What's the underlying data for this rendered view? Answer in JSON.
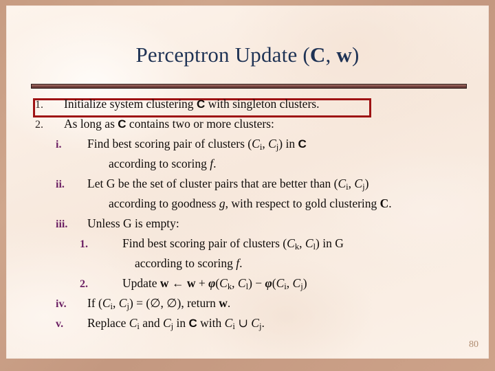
{
  "slide": {
    "title_plain": "Perceptron Update (C, w)",
    "title_pre": "Perceptron Update (",
    "title_c": "C",
    "title_comma": ", ",
    "title_w": "w",
    "title_post": ")",
    "page_number": "80",
    "accent_colors": {
      "title": "#1f3355",
      "highlight_box": "#9e1213",
      "roman_marker": "#6b1f63",
      "divider": "#7d4a45",
      "page_number": "#b08d72",
      "background_frame": "#c79c82",
      "paper": "#faeee4"
    }
  },
  "items": [
    {
      "marker": "1.",
      "level": 1,
      "highlighted": true,
      "text": "Initialize system clustering C with singleton clusters.",
      "parts": {
        "a": "Initialize system clustering ",
        "b": "C",
        "c": " with singleton clusters."
      }
    },
    {
      "marker": "2.",
      "level": 1,
      "highlighted": false,
      "text": "As long as C contains two or more clusters:",
      "parts": {
        "a": "As long as ",
        "b": "C",
        "c": " contains two or more clusters:"
      }
    },
    {
      "marker": "i.",
      "level": 2,
      "highlighted": false,
      "text": "Find best scoring pair of clusters (Ci, Cj) in C",
      "parts": {
        "a": "Find best scoring pair of clusters (",
        "b": "C",
        "sub1": "i",
        "c": ", ",
        "d": "C",
        "sub2": "j",
        "e": ") in ",
        "f": "C"
      },
      "continuation": {
        "a": "according to scoring ",
        "b": "f",
        "c": "."
      }
    },
    {
      "marker": "ii.",
      "level": 2,
      "highlighted": false,
      "text": "Let G be the set of cluster pairs that are better than (Ci, Cj)",
      "parts": {
        "a": "Let G be the set of cluster pairs that are better than (",
        "b": "C",
        "sub1": "i",
        "c": ", ",
        "d": "C",
        "sub2": "j",
        "e": ")"
      },
      "continuation": {
        "a": "according to goodness ",
        "b": "g",
        "c": ", with respect to gold clustering ",
        "d": "C",
        "e": "."
      }
    },
    {
      "marker": "iii.",
      "level": 2,
      "highlighted": false,
      "text": "Unless G is empty:"
    },
    {
      "marker": "1.",
      "level": 3,
      "highlighted": false,
      "text": "Find best scoring pair of clusters (Ck, Cl) in G",
      "parts": {
        "a": "Find best scoring pair of clusters (",
        "b": "C",
        "sub1": "k",
        "c": ", ",
        "d": "C",
        "sub2": "l",
        "e": ") in G"
      },
      "continuation": {
        "a": "according to scoring ",
        "b": "f",
        "c": "."
      }
    },
    {
      "marker": "2.",
      "level": 3,
      "highlighted": false,
      "text": "Update w ← w + φ(Ck, Cl) − φ(Ci, Cj)",
      "parts": {
        "a": "Update ",
        "w1": "w",
        "arrow": " ← ",
        "w2": "w",
        "plus": " + ",
        "phi1": "φ",
        "open1": "(",
        "c1": "C",
        "sub1": "k",
        "comma1": ", ",
        "c2": "C",
        "sub2": "l",
        "close1": ")",
        "minus": " − ",
        "phi2": "φ",
        "open2": "(",
        "c3": "C",
        "sub3": "i",
        "comma2": ", ",
        "c4": "C",
        "sub4": "j",
        "close2": ")"
      }
    },
    {
      "marker": "iv.",
      "level": 2,
      "highlighted": false,
      "text": "If (Ci, Cj) = (∅, ∅), return w.",
      "parts": {
        "a": "If  (",
        "b": "C",
        "sub1": "i",
        "c": ", ",
        "d": "C",
        "sub2": "j",
        "e": ") = (∅, ∅), return ",
        "w": "w",
        "f": "."
      }
    },
    {
      "marker": "v.",
      "level": 2,
      "highlighted": false,
      "text": "Replace Ci and Cj in C with Ci ∪ Cj.",
      "parts": {
        "a": "Replace ",
        "b": "C",
        "sub1": "i",
        "c": " and ",
        "d": "C",
        "sub2": "j",
        "e": " in ",
        "f": "C",
        "g": " with ",
        "h": "C",
        "sub3": "i",
        "i": " ∪ ",
        "j": "C",
        "sub4": "j",
        "k": "."
      }
    }
  ]
}
